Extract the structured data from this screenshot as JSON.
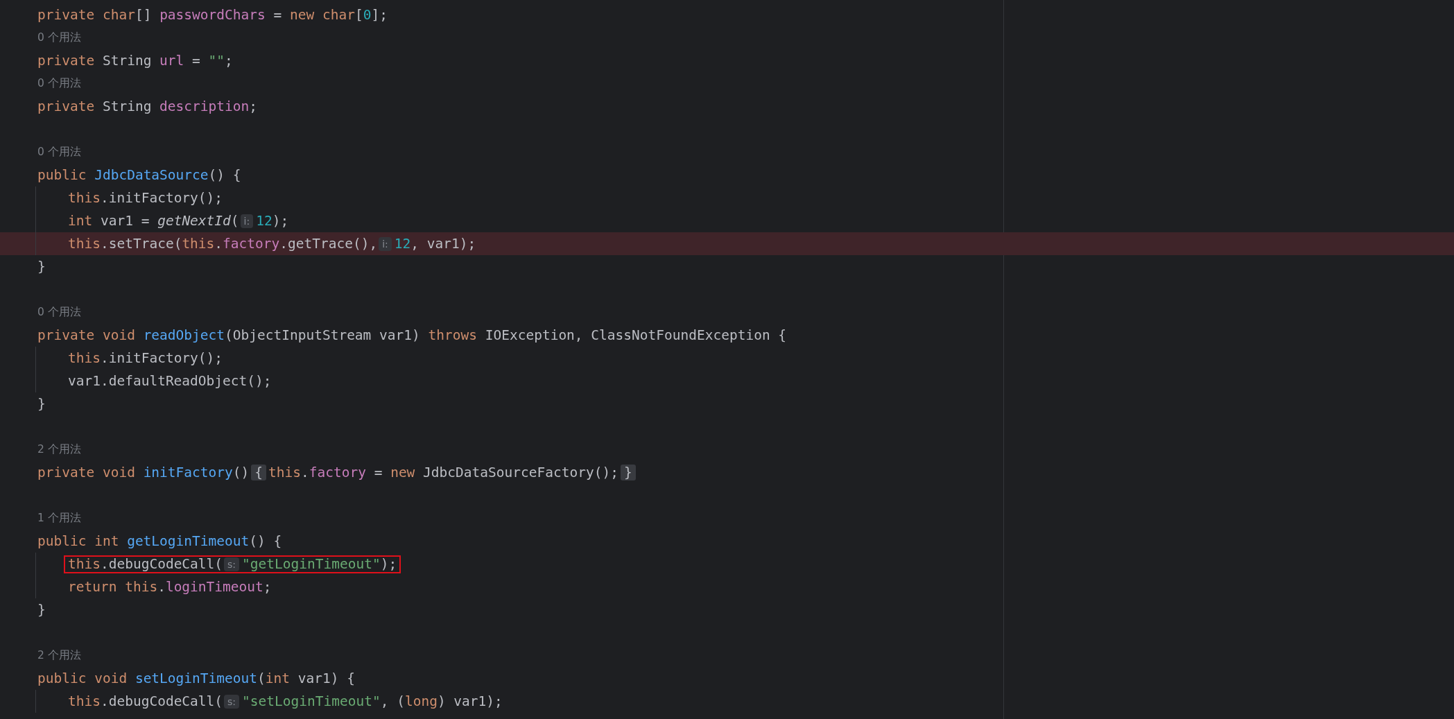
{
  "lines": [
    {
      "kind": "code",
      "highlighted": false,
      "boxed": false,
      "tokens": [
        {
          "kind": "keyword",
          "text": "private char"
        },
        {
          "kind": "plain",
          "text": "[] "
        },
        {
          "kind": "field",
          "text": "passwordChars"
        },
        {
          "kind": "plain",
          "text": " = "
        },
        {
          "kind": "keyword",
          "text": "new char"
        },
        {
          "kind": "plain",
          "text": "["
        },
        {
          "kind": "number",
          "text": "0"
        },
        {
          "kind": "plain",
          "text": "];"
        }
      ]
    },
    {
      "kind": "usages",
      "text": "0 个用法"
    },
    {
      "kind": "code",
      "highlighted": false,
      "boxed": false,
      "tokens": [
        {
          "kind": "keyword",
          "text": "private"
        },
        {
          "kind": "plain",
          "text": " String "
        },
        {
          "kind": "field",
          "text": "url"
        },
        {
          "kind": "plain",
          "text": " = "
        },
        {
          "kind": "string",
          "text": "\"\""
        },
        {
          "kind": "plain",
          "text": ";"
        }
      ]
    },
    {
      "kind": "usages",
      "text": "0 个用法"
    },
    {
      "kind": "code",
      "highlighted": false,
      "boxed": false,
      "tokens": [
        {
          "kind": "keyword",
          "text": "private"
        },
        {
          "kind": "plain",
          "text": " String "
        },
        {
          "kind": "field",
          "text": "description"
        },
        {
          "kind": "plain",
          "text": ";"
        }
      ]
    },
    {
      "kind": "blank"
    },
    {
      "kind": "usages",
      "text": "0 个用法"
    },
    {
      "kind": "code",
      "highlighted": false,
      "boxed": false,
      "tokens": [
        {
          "kind": "keyword",
          "text": "public "
        },
        {
          "kind": "declaration",
          "text": "JdbcDataSource"
        },
        {
          "kind": "plain",
          "text": "() {"
        }
      ],
      "children": [
        {
          "kind": "code",
          "highlighted": false,
          "boxed": false,
          "tokens": [
            {
              "kind": "keyword",
              "text": "this"
            },
            {
              "kind": "plain",
              "text": ".initFactory();"
            }
          ]
        },
        {
          "kind": "code",
          "highlighted": false,
          "boxed": false,
          "tokens": [
            {
              "kind": "keyword",
              "text": "int"
            },
            {
              "kind": "plain",
              "text": " var1 = "
            },
            {
              "kind": "italic",
              "text": "getNextId"
            },
            {
              "kind": "plain",
              "text": "("
            },
            {
              "kind": "hint",
              "text": "i:"
            },
            {
              "kind": "number",
              "text": "12"
            },
            {
              "kind": "plain",
              "text": ");"
            }
          ]
        },
        {
          "kind": "code",
          "highlighted": true,
          "boxed": false,
          "tokens": [
            {
              "kind": "keyword",
              "text": "this"
            },
            {
              "kind": "plain",
              "text": ".setTrace("
            },
            {
              "kind": "keyword",
              "text": "this"
            },
            {
              "kind": "plain",
              "text": "."
            },
            {
              "kind": "field",
              "text": "factory"
            },
            {
              "kind": "plain",
              "text": ".getTrace(),"
            },
            {
              "kind": "hint",
              "text": "i:"
            },
            {
              "kind": "number",
              "text": "12"
            },
            {
              "kind": "plain",
              "text": ", var1);"
            }
          ]
        }
      ]
    },
    {
      "kind": "code",
      "highlighted": false,
      "boxed": false,
      "tokens": [
        {
          "kind": "plain",
          "text": "}"
        }
      ]
    },
    {
      "kind": "blank"
    },
    {
      "kind": "usages",
      "text": "0 个用法"
    },
    {
      "kind": "code",
      "highlighted": false,
      "boxed": false,
      "tokens": [
        {
          "kind": "keyword",
          "text": "private void "
        },
        {
          "kind": "declaration",
          "text": "readObject"
        },
        {
          "kind": "plain",
          "text": "(ObjectInputStream var1) "
        },
        {
          "kind": "keyword",
          "text": "throws"
        },
        {
          "kind": "plain",
          "text": " IOException, ClassNotFoundException {"
        }
      ],
      "children": [
        {
          "kind": "code",
          "highlighted": false,
          "boxed": false,
          "tokens": [
            {
              "kind": "keyword",
              "text": "this"
            },
            {
              "kind": "plain",
              "text": ".initFactory();"
            }
          ]
        },
        {
          "kind": "code",
          "highlighted": false,
          "boxed": false,
          "tokens": [
            {
              "kind": "plain",
              "text": "var1.defaultReadObject();"
            }
          ]
        }
      ]
    },
    {
      "kind": "code",
      "highlighted": false,
      "boxed": false,
      "tokens": [
        {
          "kind": "plain",
          "text": "}"
        }
      ]
    },
    {
      "kind": "blank"
    },
    {
      "kind": "usages",
      "text": "2 个用法"
    },
    {
      "kind": "code",
      "highlighted": false,
      "boxed": false,
      "tokens": [
        {
          "kind": "keyword",
          "text": "private void "
        },
        {
          "kind": "declaration",
          "text": "initFactory"
        },
        {
          "kind": "plain",
          "text": "()"
        },
        {
          "kind": "fold",
          "text": "{"
        },
        {
          "kind": "keyword",
          "text": "this"
        },
        {
          "kind": "plain",
          "text": "."
        },
        {
          "kind": "field",
          "text": "factory"
        },
        {
          "kind": "plain",
          "text": " = "
        },
        {
          "kind": "keyword",
          "text": "new"
        },
        {
          "kind": "plain",
          "text": " JdbcDataSourceFactory();"
        },
        {
          "kind": "fold",
          "text": "}"
        }
      ]
    },
    {
      "kind": "blank"
    },
    {
      "kind": "usages",
      "text": "1 个用法"
    },
    {
      "kind": "code",
      "highlighted": false,
      "boxed": false,
      "tokens": [
        {
          "kind": "keyword",
          "text": "public int "
        },
        {
          "kind": "declaration",
          "text": "getLoginTimeout"
        },
        {
          "kind": "plain",
          "text": "() {"
        }
      ],
      "children": [
        {
          "kind": "code",
          "highlighted": false,
          "boxed": true,
          "tokens": [
            {
              "kind": "keyword",
              "text": "this"
            },
            {
              "kind": "plain",
              "text": ".debugCodeCall("
            },
            {
              "kind": "hint",
              "text": "s:"
            },
            {
              "kind": "string",
              "text": "\"getLoginTimeout\""
            },
            {
              "kind": "plain",
              "text": ");"
            }
          ]
        },
        {
          "kind": "code",
          "highlighted": false,
          "boxed": false,
          "tokens": [
            {
              "kind": "keyword",
              "text": "return this"
            },
            {
              "kind": "plain",
              "text": "."
            },
            {
              "kind": "field",
              "text": "loginTimeout"
            },
            {
              "kind": "plain",
              "text": ";"
            }
          ]
        }
      ]
    },
    {
      "kind": "code",
      "highlighted": false,
      "boxed": false,
      "tokens": [
        {
          "kind": "plain",
          "text": "}"
        }
      ]
    },
    {
      "kind": "blank"
    },
    {
      "kind": "usages",
      "text": "2 个用法"
    },
    {
      "kind": "code",
      "highlighted": false,
      "boxed": false,
      "tokens": [
        {
          "kind": "keyword",
          "text": "public void "
        },
        {
          "kind": "declaration",
          "text": "setLoginTimeout"
        },
        {
          "kind": "plain",
          "text": "("
        },
        {
          "kind": "keyword",
          "text": "int"
        },
        {
          "kind": "plain",
          "text": " var1) {"
        }
      ],
      "children": [
        {
          "kind": "code",
          "highlighted": false,
          "boxed": false,
          "tokens": [
            {
              "kind": "keyword",
              "text": "this"
            },
            {
              "kind": "plain",
              "text": ".debugCodeCall("
            },
            {
              "kind": "hint",
              "text": "s:"
            },
            {
              "kind": "string",
              "text": "\"setLoginTimeout\""
            },
            {
              "kind": "plain",
              "text": ", ("
            },
            {
              "kind": "keyword",
              "text": "long"
            },
            {
              "kind": "plain",
              "text": ") var1);"
            }
          ]
        }
      ]
    }
  ]
}
